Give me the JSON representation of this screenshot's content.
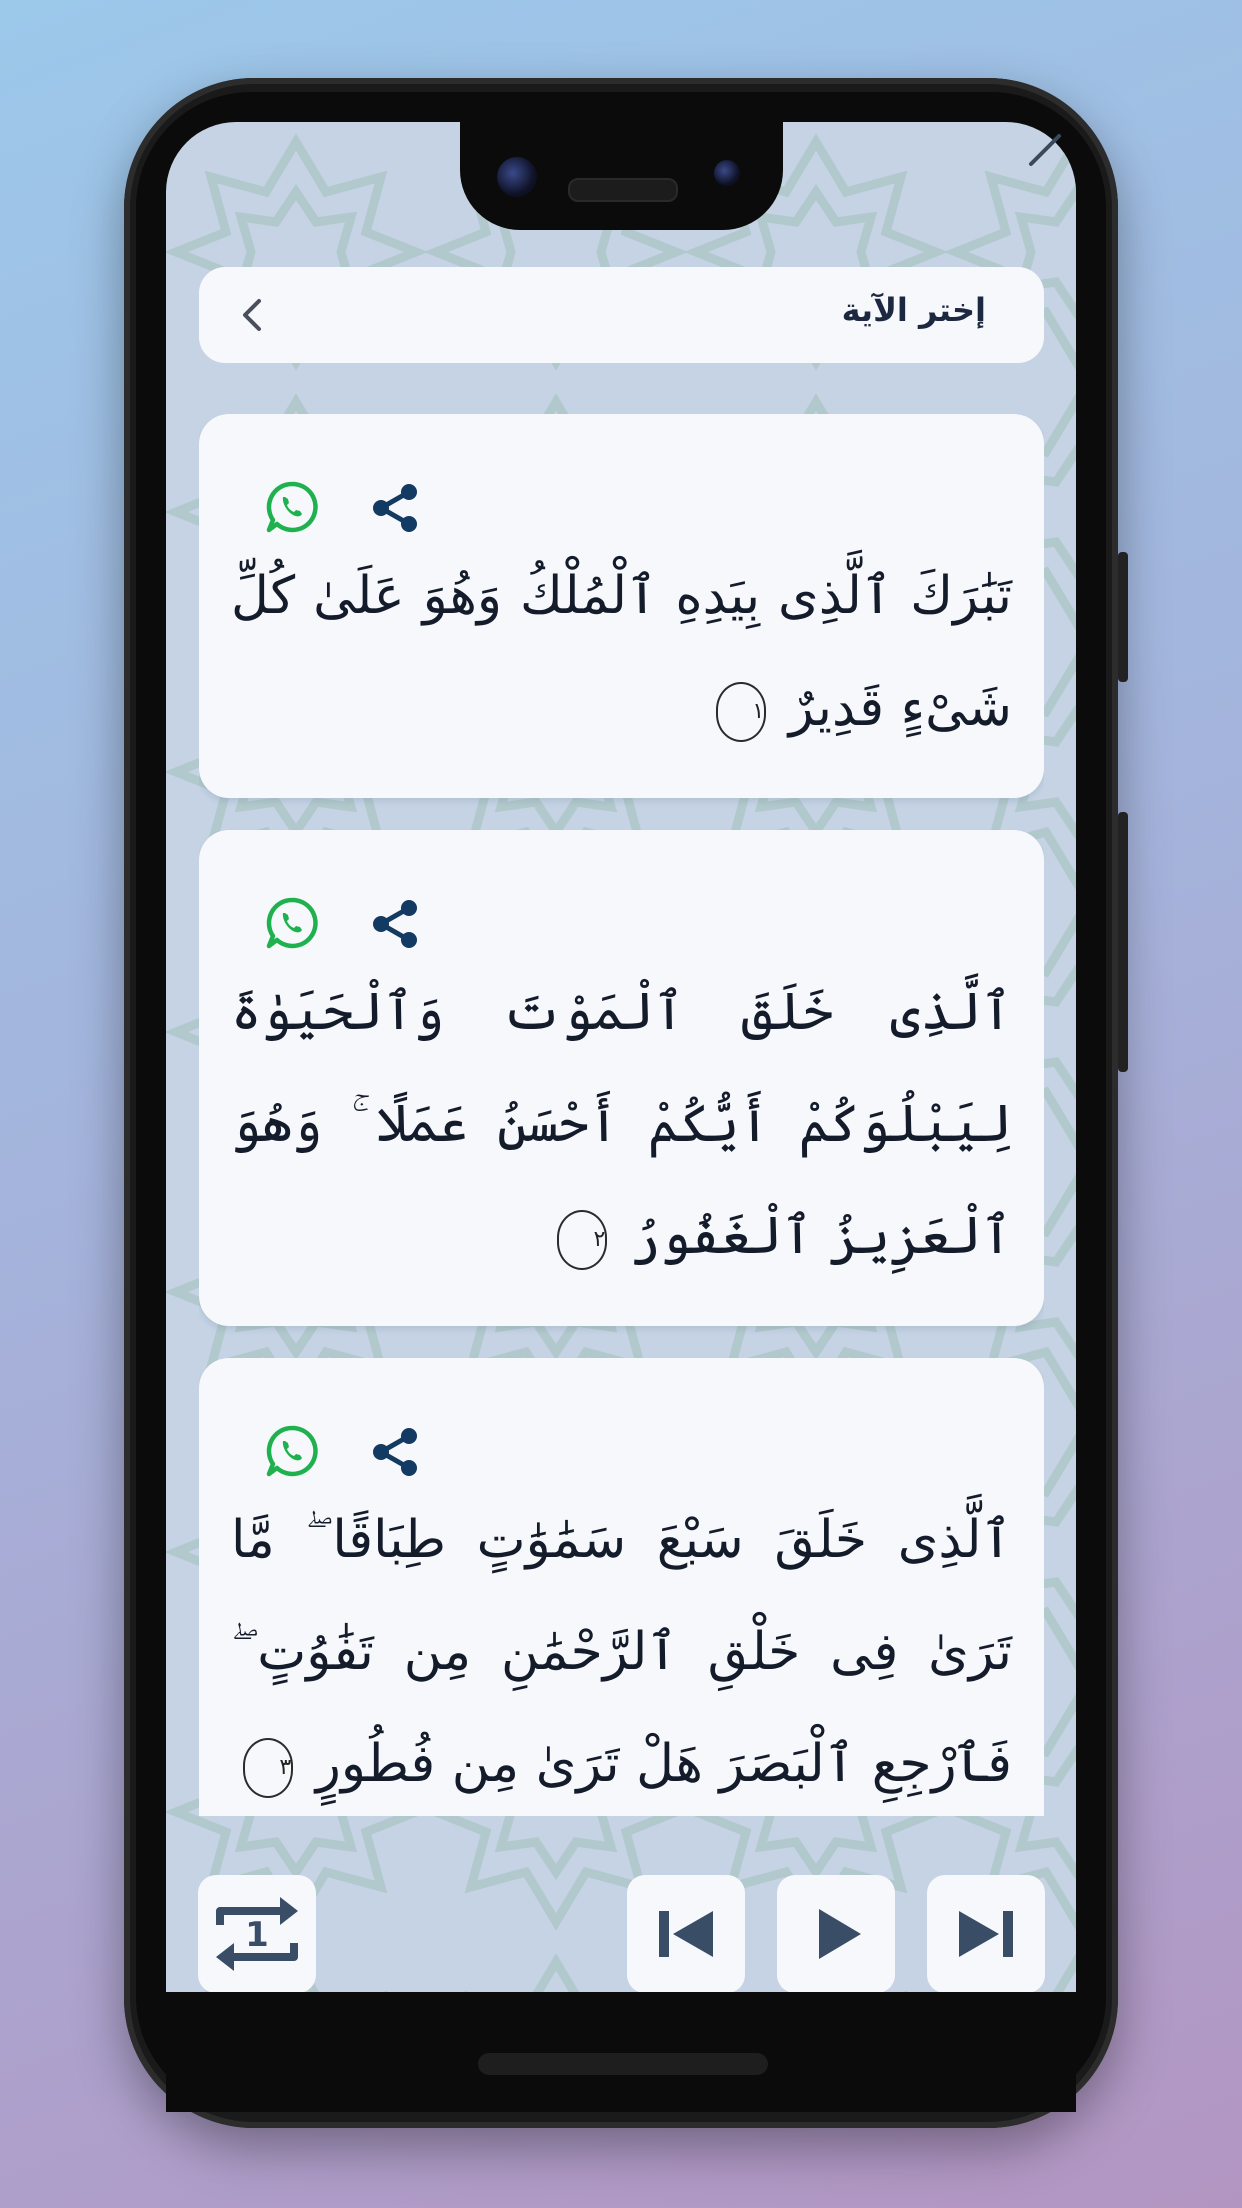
{
  "header": {
    "title": "إختر الآية"
  },
  "ayahs": [
    {
      "text": "تَبَٰرَكَ ٱلَّذِى بِيَدِهِ ٱلْمُلْكُ وَهُوَ عَلَىٰ كُلِّ شَىْءٍ قَدِيرٌ",
      "number": "١"
    },
    {
      "text": "ٱلَّذِى خَلَقَ ٱلْمَوْتَ وَٱلْحَيَوٰةَ لِيَبْلُوَكُمْ أَيُّكُمْ أَحْسَنُ عَمَلًا ۚ وَهُوَ ٱلْعَزِيزُ ٱلْغَفُورُ",
      "number": "٢"
    },
    {
      "text": "ٱلَّذِى خَلَقَ سَبْعَ سَمَٰوَٰتٍ طِبَاقًا ۖ مَّا تَرَىٰ فِى خَلْقِ ٱلرَّحْمَٰنِ مِن تَفَٰوُتٍ ۖ فَٱرْجِعِ ٱلْبَصَرَ هَلْ تَرَىٰ مِن فُطُورٍ",
      "number": "٣"
    }
  ],
  "controls": {
    "repeat": "1",
    "icons": [
      "repeat-one-icon",
      "previous-icon",
      "play-icon",
      "next-icon"
    ]
  },
  "icons": [
    "close-icon",
    "chevron-left-icon",
    "whatsapp-icon",
    "share-icon"
  ],
  "colors": {
    "whatsapp": "#1fb14f",
    "share": "#123a63",
    "ink": "#141c2c",
    "card": "#f7f8fb",
    "control": "#3a4d66"
  }
}
